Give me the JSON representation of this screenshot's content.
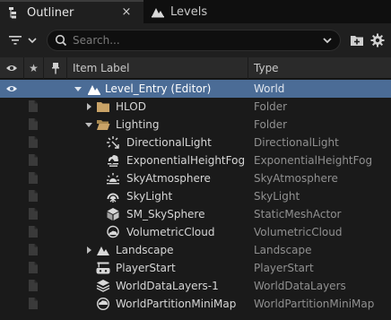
{
  "tabs": [
    {
      "label": "Outliner",
      "close": "×"
    },
    {
      "label": "Levels"
    }
  ],
  "search": {
    "placeholder": "Search..."
  },
  "columns": {
    "star": "★",
    "item_label": "Item Label",
    "type": "Type"
  },
  "colors": {
    "selected": "#4b6c96",
    "folder": "#c9a367",
    "panel": "#1a1a1a",
    "header": "#2a2a2a"
  },
  "rows": [
    {
      "label": "Level_Entry (Editor)",
      "type": "World",
      "icon": "world-icon",
      "selected": true,
      "arrow": "down",
      "depth": 0
    },
    {
      "label": "HLOD",
      "type": "Folder",
      "icon": "folder-icon",
      "arrow": "right",
      "depth": 1
    },
    {
      "label": "Lighting",
      "type": "Folder",
      "icon": "folder-open-icon",
      "arrow": "down",
      "depth": 1
    },
    {
      "label": "DirectionalLight",
      "type": "DirectionalLight",
      "icon": "directional-light-icon",
      "depth": 2
    },
    {
      "label": "ExponentialHeightFog",
      "type": "ExponentialHeightFog",
      "icon": "fog-icon",
      "depth": 2
    },
    {
      "label": "SkyAtmosphere",
      "type": "SkyAtmosphere",
      "icon": "sky-atmosphere-icon",
      "depth": 2
    },
    {
      "label": "SkyLight",
      "type": "SkyLight",
      "icon": "sky-light-icon",
      "depth": 2
    },
    {
      "label": "SM_SkySphere",
      "type": "StaticMeshActor",
      "icon": "static-mesh-icon",
      "depth": 2
    },
    {
      "label": "VolumetricCloud",
      "type": "VolumetricCloud",
      "icon": "cloud-icon",
      "depth": 2
    },
    {
      "label": "Landscape",
      "type": "Landscape",
      "icon": "landscape-icon",
      "arrow": "right",
      "depth": 1
    },
    {
      "label": "PlayerStart",
      "type": "PlayerStart",
      "icon": "player-start-icon",
      "depth": 1
    },
    {
      "label": "WorldDataLayers-1",
      "type": "WorldDataLayers",
      "icon": "data-layers-icon",
      "depth": 1
    },
    {
      "label": "WorldPartitionMiniMap",
      "type": "WorldPartitionMiniMap",
      "icon": "minimap-icon",
      "depth": 1
    }
  ]
}
